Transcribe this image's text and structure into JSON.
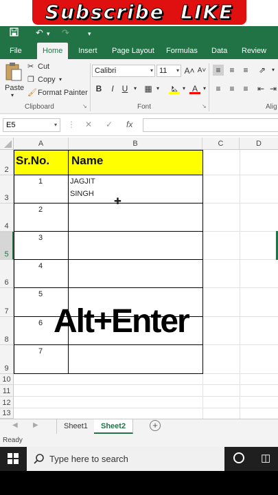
{
  "banner": {
    "text": "Subscribe  LIKE"
  },
  "qat": {
    "save_icon": "save-icon",
    "undo_icon": "undo-icon",
    "redo_icon": "redo-icon"
  },
  "tabs": [
    "File",
    "Home",
    "Insert",
    "Page Layout",
    "Formulas",
    "Data",
    "Review"
  ],
  "active_tab": "Home",
  "ribbon": {
    "paste_label": "Paste",
    "cut_label": "Cut",
    "copy_label": "Copy",
    "format_painter_label": "Format Painter",
    "clipboard_group": "Clipboard",
    "font_name": "Calibri",
    "font_size": "11",
    "font_group": "Font",
    "alignment_group": "Alig",
    "bold": "B",
    "italic": "I",
    "underline": "U",
    "grow_font": "A˄",
    "shrink_font": "A˅",
    "font_color": "A"
  },
  "formula_bar": {
    "name_box": "E5",
    "cancel": "✕",
    "enter": "✓",
    "fx": "fx",
    "value": ""
  },
  "columns": [
    "A",
    "B",
    "C",
    "D"
  ],
  "rows": [
    "2",
    "3",
    "4",
    "5",
    "6",
    "7",
    "8",
    "9",
    "10",
    "11",
    "12",
    "13"
  ],
  "table": {
    "headers": [
      "Sr.No.",
      "Name"
    ],
    "header_color": "#ffff00",
    "rows": [
      {
        "sr": "1",
        "name_line1": "JAGJIT",
        "name_line2": "SINGH"
      },
      {
        "sr": "2",
        "name_line1": "",
        "name_line2": ""
      },
      {
        "sr": "3",
        "name_line1": "",
        "name_line2": ""
      },
      {
        "sr": "4",
        "name_line1": "",
        "name_line2": ""
      },
      {
        "sr": "5",
        "name_line1": "",
        "name_line2": ""
      },
      {
        "sr": "6",
        "name_line1": "",
        "name_line2": ""
      },
      {
        "sr": "7",
        "name_line1": "",
        "name_line2": ""
      }
    ]
  },
  "overlay_text": "Alt+Enter",
  "sheets": [
    "Sheet1",
    "Sheet2"
  ],
  "active_sheet": "Sheet2",
  "status": "Ready",
  "taskbar": {
    "search_placeholder": "Type here to search"
  },
  "colors": {
    "excel_green": "#217346",
    "banner_red": "#e01010"
  }
}
